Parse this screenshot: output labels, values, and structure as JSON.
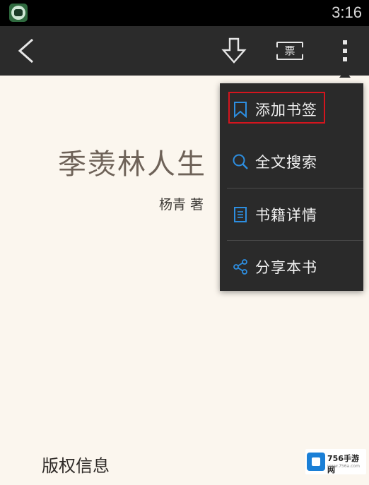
{
  "status_bar": {
    "time": "3:16",
    "app_icon": "book-app-icon"
  },
  "toolbar": {
    "back_icon": "chevron-left-icon",
    "download_icon": "download-arrow-icon",
    "ticket_label": "票",
    "more_icon": "more-vertical-icon"
  },
  "book": {
    "title": "季羡林人生",
    "author": "杨青 著",
    "copyright_heading": "版权信息"
  },
  "menu": {
    "items": [
      {
        "label": "添加书签",
        "icon": "bookmark-icon"
      },
      {
        "label": "全文搜索",
        "icon": "search-icon"
      },
      {
        "label": "书籍详情",
        "icon": "document-icon"
      },
      {
        "label": "分享本书",
        "icon": "share-icon"
      }
    ],
    "accent_color": "#2d8ee0",
    "highlight_color": "#d4151e"
  },
  "watermark": {
    "brand": "756手游网",
    "url": "www.756a.com"
  }
}
